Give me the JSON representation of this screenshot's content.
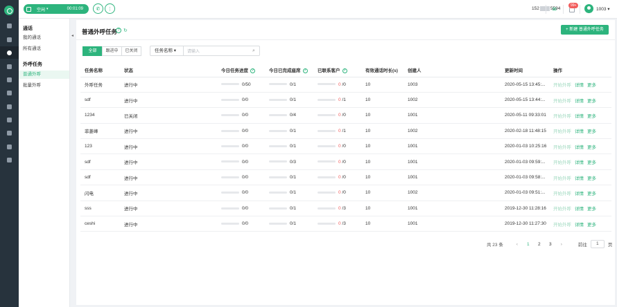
{
  "topbar": {
    "status": "空闲",
    "timer": "00:01:09",
    "phone_prefix": "152",
    "phone_suffix": "5594",
    "notif_badge": "99+",
    "user": "1003"
  },
  "sidebar": {
    "groups": [
      {
        "title": "通话",
        "items": [
          {
            "label": "我的通话"
          },
          {
            "label": "所有通话"
          }
        ]
      },
      {
        "title": "外呼任务",
        "items": [
          {
            "label": "普通外呼",
            "active": true
          },
          {
            "label": "批量外呼"
          }
        ]
      }
    ]
  },
  "page": {
    "title": "普通外呼任务",
    "new_button": "+ 新建 普通外呼任务",
    "tabs": [
      {
        "label": "全部",
        "active": true
      },
      {
        "label": "跟进中"
      },
      {
        "label": "已关闭"
      }
    ],
    "filter_select": "任务名称",
    "search_placeholder": "请输入"
  },
  "table": {
    "headers": [
      "任务名称",
      "状态",
      "今日任务进度",
      "今日已完成座席",
      "已联系客户",
      "有效通话时长(s)",
      "创建人",
      "更新时间",
      "操作"
    ],
    "actions": [
      "开始外呼",
      "详情",
      "更多"
    ],
    "rows": [
      {
        "name": "外呼任务",
        "status": "进行中",
        "progress": "0/50",
        "agents": "0/1",
        "contacted": "0",
        "contacted_total": "/0",
        "duration": "10",
        "creator": "1003",
        "updated": "2020-05-15 13:45:..."
      },
      {
        "name": "sdf",
        "status": "进行中",
        "progress": "0/0",
        "agents": "0/1",
        "contacted": "0",
        "contacted_total": "/1",
        "duration": "10",
        "creator": "1002",
        "updated": "2020-05-15 13:44:..."
      },
      {
        "name": "1234",
        "status": "已关闭",
        "progress": "0/0",
        "agents": "0/4",
        "contacted": "0",
        "contacted_total": "/0",
        "duration": "10",
        "creator": "1001",
        "updated": "2020-05-11 09:33:01"
      },
      {
        "name": "菲菱峰",
        "status": "进行中",
        "progress": "0/0",
        "agents": "0/1",
        "contacted": "0",
        "contacted_total": "/1",
        "duration": "10",
        "creator": "1002",
        "updated": "2020-02-18 11:48:15"
      },
      {
        "name": "123",
        "status": "进行中",
        "progress": "0/0",
        "agents": "0/1",
        "contacted": "0",
        "contacted_total": "/0",
        "duration": "10",
        "creator": "1001",
        "updated": "2020-01-03 10:25:16"
      },
      {
        "name": "sdf",
        "status": "进行中",
        "progress": "0/0",
        "agents": "0/3",
        "contacted": "0",
        "contacted_total": "/0",
        "duration": "10",
        "creator": "1001",
        "updated": "2020-01-03 09:59:..."
      },
      {
        "name": "sdf",
        "status": "进行中",
        "progress": "0/0",
        "agents": "0/1",
        "contacted": "0",
        "contacted_total": "/0",
        "duration": "10",
        "creator": "1001",
        "updated": "2020-01-03 09:58:..."
      },
      {
        "name": "闪电",
        "status": "进行中",
        "progress": "0/0",
        "agents": "0/1",
        "contacted": "0",
        "contacted_total": "/0",
        "duration": "10",
        "creator": "1002",
        "updated": "2020-01-03 09:51:..."
      },
      {
        "name": "sss",
        "status": "进行中",
        "progress": "0/0",
        "agents": "0/1",
        "contacted": "0",
        "contacted_total": "/3",
        "duration": "10",
        "creator": "1001",
        "updated": "2019-12-30 11:28:16"
      },
      {
        "name": "ceshi",
        "status": "进行中",
        "progress": "0/0",
        "agents": "0/1",
        "contacted": "0",
        "contacted_total": "/3",
        "duration": "10",
        "creator": "1001",
        "updated": "2019-12-30 11:27:30"
      }
    ]
  },
  "pager": {
    "total": "共 23 条",
    "pages": [
      "1",
      "2",
      "3"
    ],
    "current": "1",
    "goto_label": "前往",
    "goto_value": "1",
    "page_unit": "页"
  }
}
